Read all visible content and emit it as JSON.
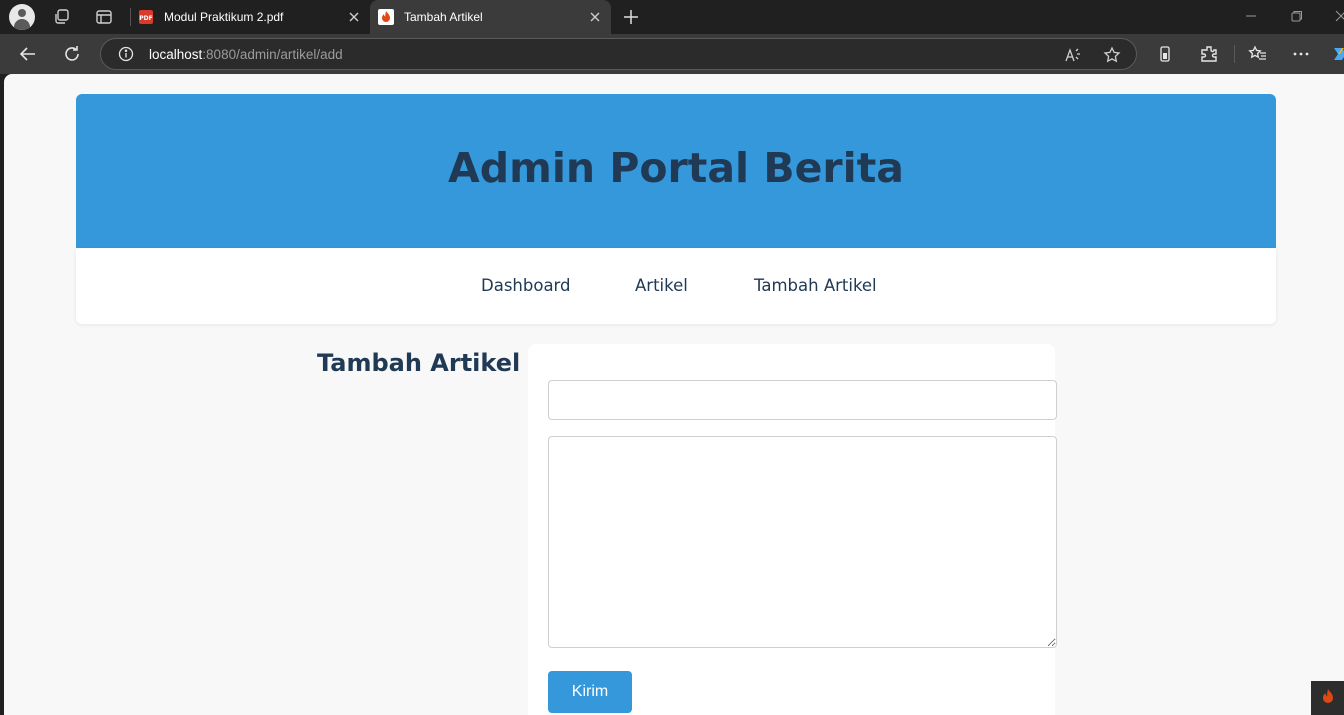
{
  "browser": {
    "tabs": [
      {
        "title": "Modul Praktikum 2.pdf",
        "icon": "pdf-icon",
        "active": false
      },
      {
        "title": "Tambah Artikel",
        "icon": "codeigniter-flame-icon",
        "active": true
      }
    ],
    "url": {
      "host": "localhost",
      "rest": ":8080/admin/artikel/add"
    }
  },
  "page": {
    "header_title": "Admin Portal Berita",
    "nav": {
      "dashboard": "Dashboard",
      "artikel": "Artikel",
      "tambah": "Tambah Artikel"
    },
    "section_title": "Tambah Artikel",
    "form": {
      "title_value": "",
      "content_value": "",
      "submit_label": "Kirim"
    }
  },
  "colors": {
    "header_bg": "#3598db",
    "heading_text": "#203a55",
    "page_bg": "#f8f8f8",
    "button_bg": "#3598db"
  }
}
